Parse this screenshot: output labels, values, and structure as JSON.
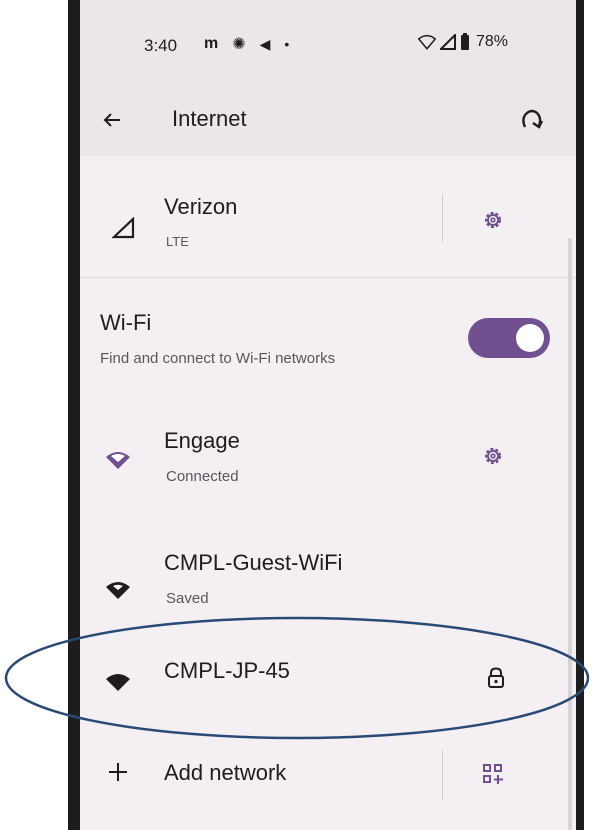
{
  "status_bar": {
    "time": "3:40",
    "battery_percent": "78%"
  },
  "app_bar": {
    "title": "Internet"
  },
  "mobile": {
    "carrier": "Verizon",
    "network_type": "LTE"
  },
  "wifi": {
    "label": "Wi-Fi",
    "description": "Find and connect to Wi-Fi networks",
    "enabled": true
  },
  "networks": [
    {
      "name": "Engage",
      "status": "Connected",
      "icon": "wifi-connected-icon",
      "trailing_icon": "settings-gear-icon"
    },
    {
      "name": "CMPL-Guest-WiFi",
      "status": "Saved",
      "icon": "wifi-icon"
    },
    {
      "name": "CMPL-JP-45",
      "status": "",
      "icon": "wifi-icon",
      "trailing_icon": "lock-icon"
    }
  ],
  "add_network": {
    "label": "Add network",
    "trailing_icon": "qr-code-scanner-icon"
  },
  "colors": {
    "accent": "#70508e",
    "background": "#f3eff3",
    "annotation": "#2a4a76"
  }
}
